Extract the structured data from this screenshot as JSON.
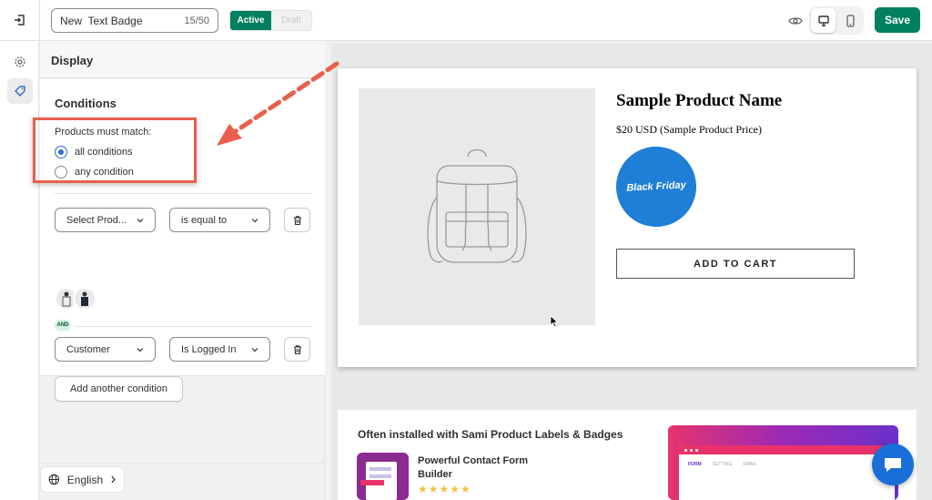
{
  "header": {
    "badge_name": "New  Text Badge",
    "char_count": "15/50",
    "status_active": "Active",
    "status_draft": "Draft",
    "save_label": "Save"
  },
  "panel": {
    "title": "Display",
    "conditions_title": "Conditions",
    "match_label": "Products must match:",
    "options": [
      "all conditions",
      "any condition"
    ],
    "selected_option": "all conditions",
    "condition1": {
      "field": "Select Prod...",
      "operator": "is equal to"
    },
    "and_label": "AND",
    "condition2": {
      "field": "Customer",
      "operator": "Is Logged In"
    },
    "add_condition": "Add another condition",
    "language": "English"
  },
  "preview": {
    "product_name": "Sample Product Name",
    "product_price": "$20 USD (Sample Product Price)",
    "badge_text": "Black Friday",
    "badge_color": "#1f7fd6",
    "add_to_cart": "ADD TO CART"
  },
  "promo": {
    "title": "Often installed with Sami Product Labels & Badges",
    "app_name": "Powerful Contact Form Builder",
    "rating_stars": 5,
    "screenshot_tabs": [
      "FORM",
      "SETTING",
      "EMAIL"
    ]
  },
  "colors": {
    "primary": "#008060",
    "annotation": "#e8604c",
    "chat": "#1a6ed8"
  }
}
